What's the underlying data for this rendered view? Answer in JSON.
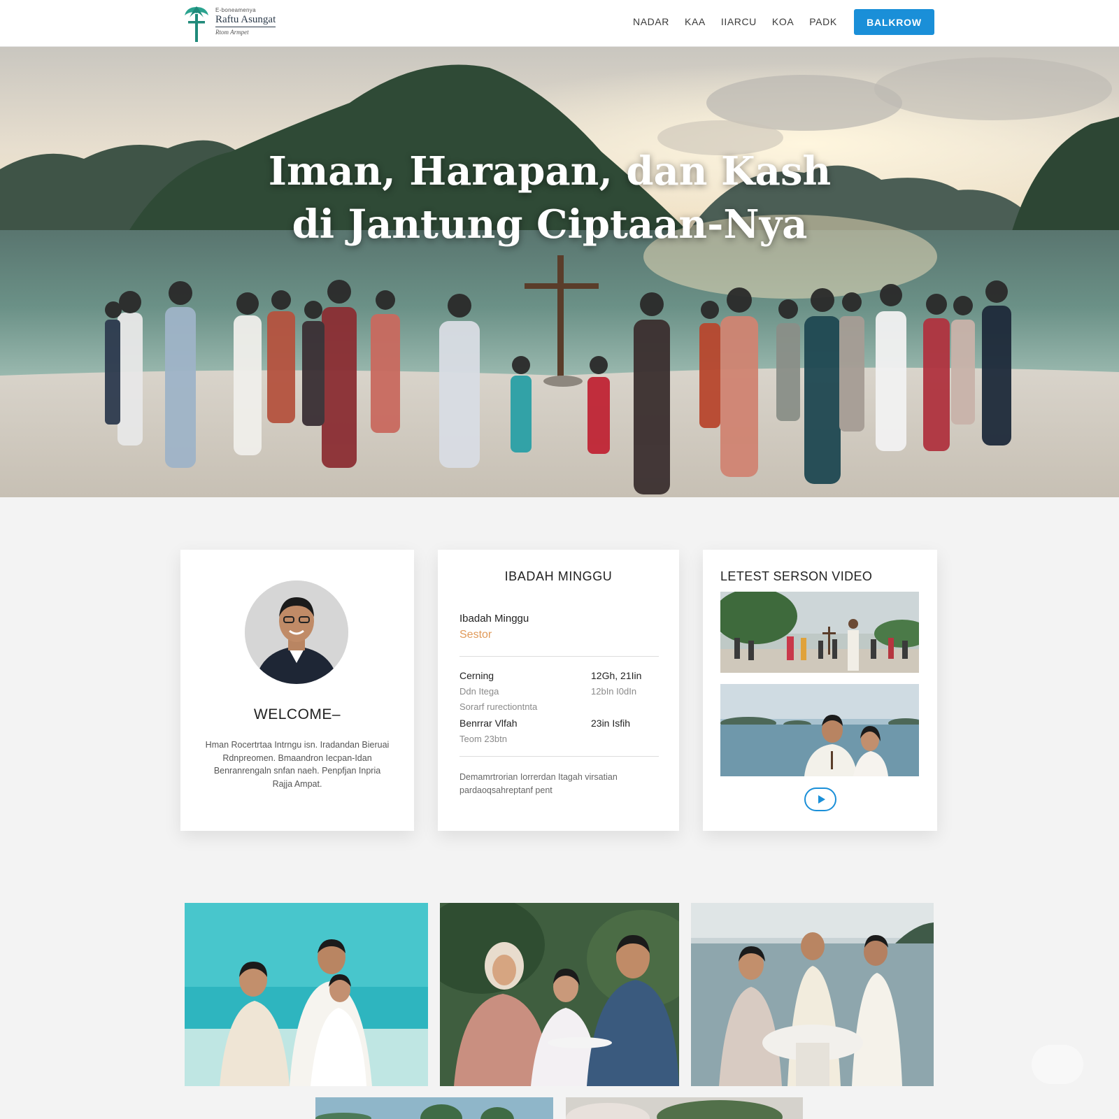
{
  "header": {
    "logo": {
      "kicker": "E-boneamenya",
      "title": "Raftu Asungat",
      "subtitle": "Rtom Armpet",
      "icon": "palm-cross-icon"
    },
    "nav": [
      "NADAR",
      "KAA",
      "IIARCU",
      "KOA",
      "PADK"
    ],
    "cta_label": "BALKROW",
    "accent_color": "#1a8fd8"
  },
  "hero": {
    "title_line1": "Iman, Harapan, dan Kash",
    "title_line2": "di Jantung Ciptaan-Nya"
  },
  "welcome": {
    "heading": "WELCOME–",
    "text": "Hman Rocertrtaa Intrngu isn. Iradandan Bieruai Rdnpreomen. Bmaandron Iecpan-Idan Benranrengaln snfan naeh. Penpfjan Inpria Rajja Ampat."
  },
  "ibadah": {
    "title": "IBADAH MINGGU",
    "subtitle": "Ibadah Minggu",
    "subtitle_accent": "Sestor",
    "accent_color": "#e09a5a",
    "rows": [
      {
        "label": "Cerning",
        "value": "12Gh, 21Iin",
        "style": "strong"
      },
      {
        "label": "Ddn Itega",
        "value": "12bIn I0dIn",
        "style": "muted"
      },
      {
        "label": "Sorarf rurectiontnta",
        "value": "",
        "style": "muted"
      },
      {
        "label": "Benrrar Vlfah",
        "value": "23in Isfih",
        "style": "strong"
      },
      {
        "label": "Teom 23btn",
        "value": "",
        "style": "muted"
      }
    ],
    "footer": "Demamrtrorian Iorrerdan Itagah virsatian pardaoqsahreptanf pent"
  },
  "video": {
    "title": "LETEST SERSON VIDEO",
    "play_icon": "play-icon"
  }
}
